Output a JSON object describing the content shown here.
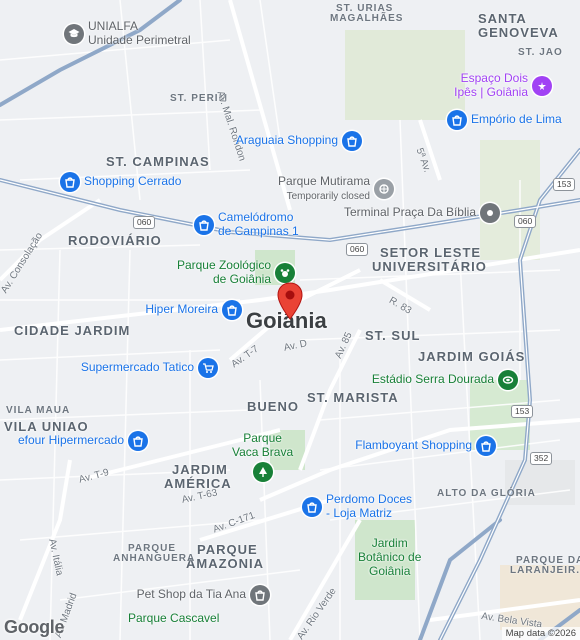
{
  "city": "Goiânia",
  "districts": {
    "st_campinas": "ST. CAMPINAS",
    "rodoviario": "RODOVIÁRIO",
    "cidade_jardim": "CIDADE JARDIM",
    "vila_maua": "VILA MAUA",
    "vila_uniao": "VILA UNIAO",
    "bueno": "BUENO",
    "st_marista": "ST. MARISTA",
    "st_sul": "ST. SUL",
    "jardim_goias": "JARDIM GOIÁS",
    "setor_leste_1": "SETOR LESTE",
    "setor_leste_2": "UNIVERSITÁRIO",
    "santa_genoveva_1": "SANTA",
    "santa_genoveva_2": "GENOVEVA",
    "jardim_america_1": "JARDIM",
    "jardim_america_2": "AMÉRICA",
    "parque_amazonia_1": "PARQUE",
    "parque_amazonia_2": "AMAZONIA",
    "st_perim": "ST. PERIM",
    "st_jao": "ST. JAO",
    "st_urias_1": "ST. URIAS",
    "st_urias_2": "MAGALHÃES",
    "alto_da_gloria": "ALTO DA GLÓRIA",
    "parque_anhanguera_1": "PARQUE",
    "parque_anhanguera_2": "ANHANGUERA",
    "parque_laranjeiras_1": "PARQUE DA",
    "parque_laranjeiras_2": "LARANJEIR..."
  },
  "streets": {
    "mal_rondon": "Av. Mal. Rondon",
    "consolacao": "Av. Consolação",
    "t7": "Av. T-7",
    "av_d": "Av. D",
    "av_85": "Av. 85",
    "r83": "R. 83",
    "t9": "Av. T-9",
    "t63": "Av. T-63",
    "c171": "Av. C-171",
    "italia": "Av. Itália",
    "madrid": "Av. Madrid",
    "rio_verde": "Av. Rio Verde",
    "bela_vista": "Av. Bela Vista",
    "quinta_av": "5ª Av."
  },
  "highways": [
    "060",
    "060",
    "060",
    "153",
    "153",
    "352"
  ],
  "pois": {
    "unialfa": {
      "line1": "UNIALFA",
      "line2": "Unidade Perimetral",
      "icon": "school-icon",
      "color": "#70757a"
    },
    "espaco": {
      "line1": "Espaço Dois",
      "line2": "Ipês | Goiânia",
      "icon": "event-icon",
      "color": "#a142f4"
    },
    "emporio": {
      "line1": "Empório de Lima",
      "icon": "shopping-bag-icon",
      "color": "#1a73e8"
    },
    "araguaia": {
      "line1": "Araguaia Shopping",
      "icon": "shopping-bag-icon",
      "color": "#1a73e8"
    },
    "shopping_cerrado": {
      "line1": "Shopping Cerrado",
      "icon": "shopping-bag-icon",
      "color": "#1a73e8"
    },
    "mutirama": {
      "line1": "Parque Mutirama",
      "line2": "Temporarily closed",
      "icon": "park-icon",
      "color": "#70757a"
    },
    "camelodromo": {
      "line1": "Camelódromo",
      "line2": "de Campinas 1",
      "icon": "shopping-bag-icon",
      "color": "#1a73e8"
    },
    "terminal": {
      "line1": "Terminal Praça Da Bíblia",
      "icon": "bus-stop-icon",
      "color": "#70757a"
    },
    "zoologico": {
      "line1": "Parque Zoológico",
      "line2": "de Goiânia",
      "icon": "zoo-icon",
      "color": "#188038"
    },
    "hiper_moreira": {
      "line1": "Hiper Moreira",
      "icon": "shopping-bag-icon",
      "color": "#1a73e8"
    },
    "supermercado": {
      "line1": "Supermercado Tatico",
      "icon": "cart-icon",
      "color": "#1a73e8"
    },
    "serra_dourada": {
      "line1": "Estádio Serra Dourada",
      "icon": "stadium-icon",
      "color": "#188038"
    },
    "hipermercado": {
      "line1": "efour Hipermercado",
      "icon": "shopping-bag-icon",
      "color": "#1a73e8"
    },
    "vaca_brava": {
      "line1": "Parque",
      "line2": "Vaca Brava",
      "icon": "tree-icon",
      "color": "#188038"
    },
    "flamboyant": {
      "line1": "Flamboyant Shopping",
      "icon": "shopping-bag-icon",
      "color": "#1a73e8"
    },
    "perdomo": {
      "line1": "Perdomo Doces",
      "line2": "- Loja Matriz",
      "icon": "shopping-bag-icon",
      "color": "#1a73e8"
    },
    "jardim_botanico": {
      "line1": "Jardim",
      "line2": "Botânico de",
      "line3": "Goiânia",
      "color": "#188038"
    },
    "pet_shop": {
      "line1": "Pet Shop da Tia Ana",
      "icon": "shopping-bag-icon",
      "color": "#70757a"
    },
    "cascavel": {
      "line1": "Parque Cascavel",
      "color": "#188038"
    }
  },
  "marker": {
    "name": "location-pin-icon",
    "color": "#ea4335"
  },
  "attribution": {
    "logo": "Google",
    "text": "Map data ©2026"
  }
}
